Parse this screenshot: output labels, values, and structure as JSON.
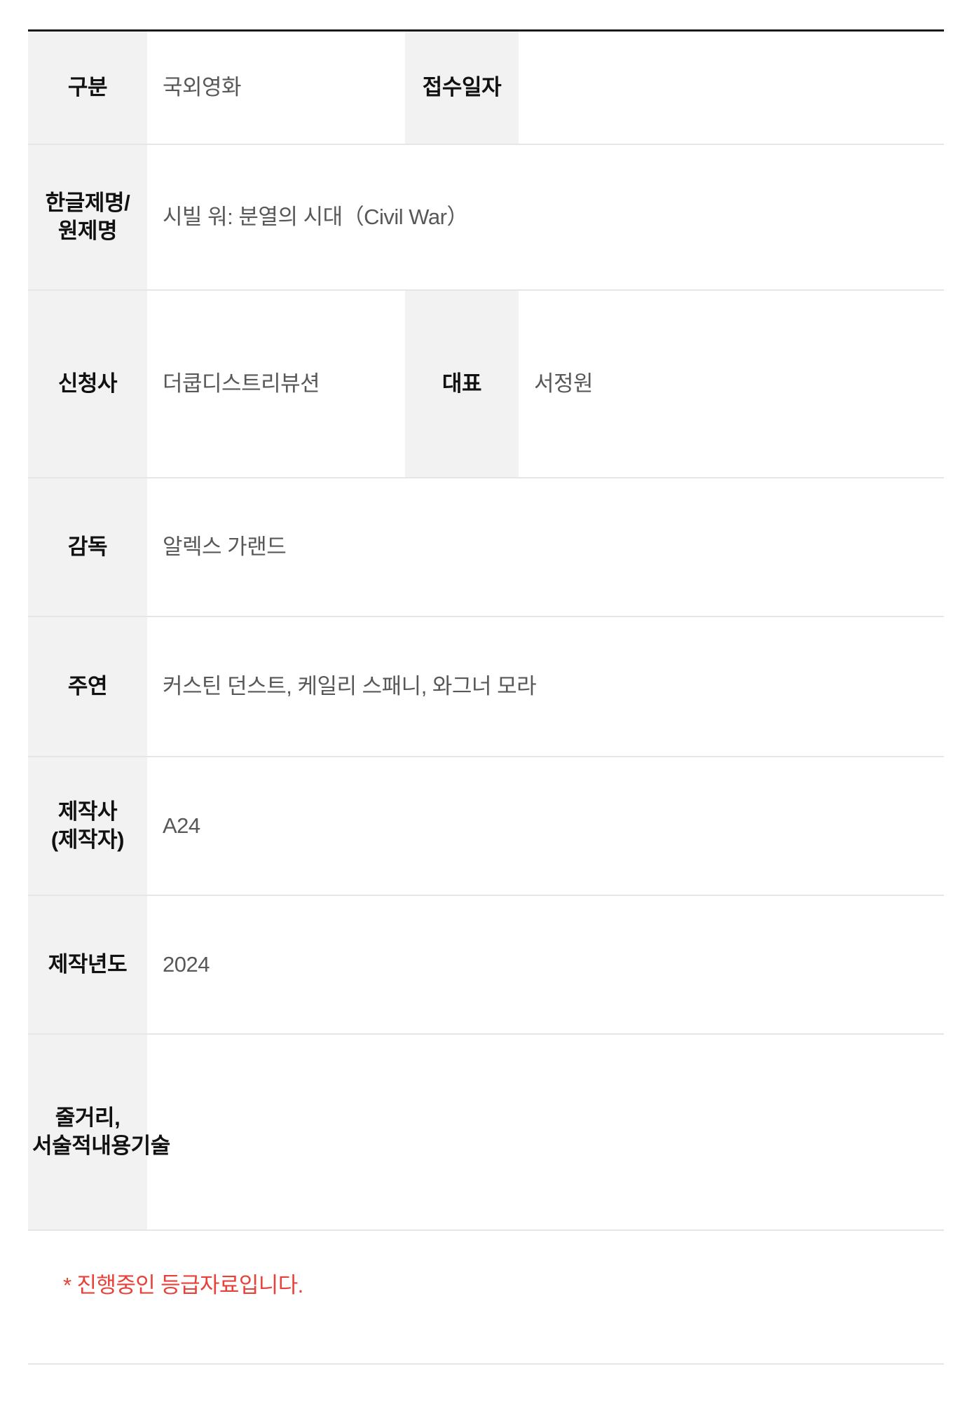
{
  "table": {
    "rows": [
      {
        "label": "구분",
        "value": "국외영화",
        "sub_label": "접수일자",
        "sub_value": ""
      },
      {
        "label": "한글제명/원제명",
        "value": "시빌 워: 분열의 시대（Civil War）"
      },
      {
        "label": "신청사",
        "value": "더쿱디스트리뷰션",
        "sub_label": "대표",
        "sub_value": "서정원"
      },
      {
        "label": "감독",
        "value": "알렉스 가랜드"
      },
      {
        "label": "주연",
        "value": "커스틴 던스트, 케일리 스패니, 와그너 모라"
      },
      {
        "label": "제작사(제작자)",
        "value": "A24"
      },
      {
        "label": "제작년도",
        "value": "2024"
      },
      {
        "label": "줄거리, 서술적내용기술",
        "value": ""
      }
    ]
  },
  "footer": {
    "notice": "* 진행중인 등급자료입니다."
  },
  "colors": {
    "label_background": "#f2f2f2",
    "label_text": "#111111",
    "value_text": "#585858",
    "top_border": "#1a1a1a",
    "row_divider": "#e6e6e6",
    "notice_text": "#e8413a"
  }
}
